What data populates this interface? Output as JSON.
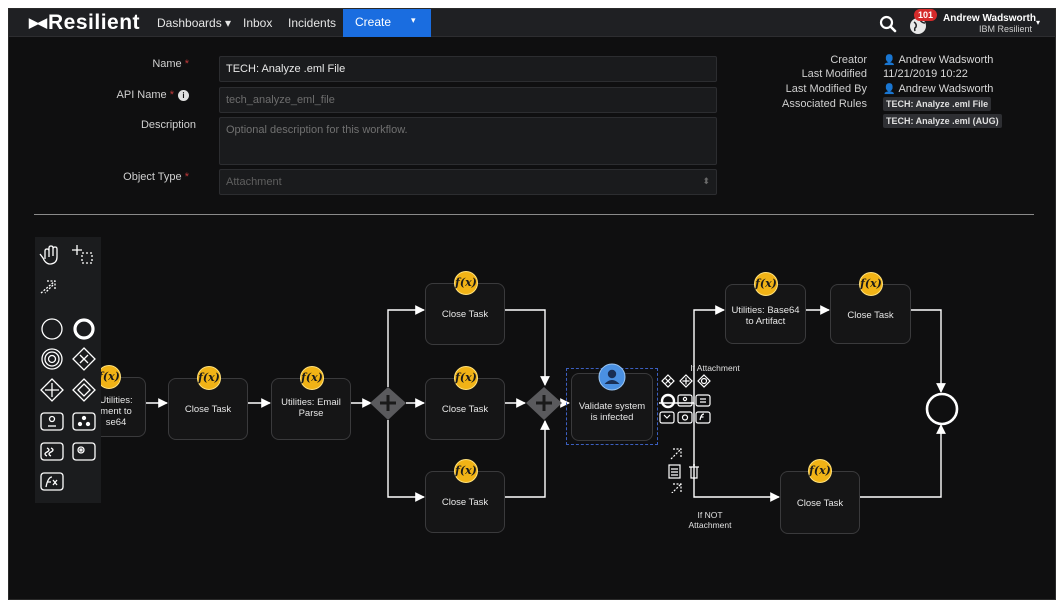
{
  "app": {
    "logo": "Resilient",
    "logo_mark": "▶◀"
  },
  "nav": {
    "dashboards": "Dashboards ▾",
    "inbox": "Inbox",
    "incidents": "Incidents",
    "create": "Create",
    "create_caret": "▾",
    "notification_count": "101",
    "user_name": "Andrew Wadsworth",
    "user_org": "IBM Resilient",
    "user_caret": "▾"
  },
  "form": {
    "name_label": "Name",
    "name_value": "TECH: Analyze .eml File",
    "api_label": "API Name",
    "api_value": "tech_analyze_eml_file",
    "description_label": "Description",
    "description_placeholder": "Optional description for this workflow.",
    "object_type_label": "Object Type",
    "object_type_value": "Attachment",
    "required_mark": "*",
    "info_glyph": "i"
  },
  "meta": {
    "creator_label": "Creator",
    "creator_value": "Andrew Wadsworth",
    "last_modified_label": "Last Modified",
    "last_modified_value": "11/21/2019 10:22",
    "last_modified_by_label": "Last Modified By",
    "last_modified_by_value": "Andrew Wadsworth",
    "associated_rules_label": "Associated Rules",
    "rules": [
      "TECH: Analyze .eml File",
      "TECH: Analyze .eml (AUG)"
    ]
  },
  "diagram": {
    "fx_glyph": "f(x)",
    "tasks": {
      "extract_1": "Utilities:",
      "extract_2": "ment to",
      "extract_3": "se64",
      "close_a": "Close Task",
      "email_parse_1": "Utilities: Email",
      "email_parse_2": "Parse",
      "close_top": "Close Task",
      "close_mid": "Close Task",
      "close_bot": "Close Task",
      "validate_1": "Validate system",
      "validate_2": "is infected",
      "base64_1": "Utilities: Base64",
      "base64_2": "to Artifact",
      "close_right_top": "Close Task",
      "close_right_bot": "Close Task"
    },
    "labels": {
      "if_attachment": "If Attachment",
      "if_not_1": "If NOT",
      "if_not_2": "Attachment"
    }
  },
  "colors": {
    "accent": "#1a6de0",
    "badge": "#d52b2b",
    "fx": "#f1b316",
    "user_task": "#4a90e2"
  }
}
